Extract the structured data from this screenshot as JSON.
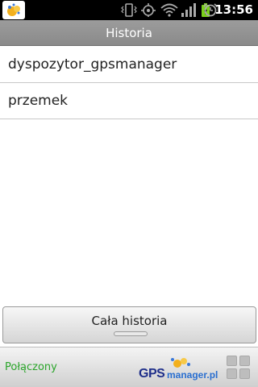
{
  "status_bar": {
    "time": "13:56",
    "icons": [
      "app-logo-icon",
      "vibrate-icon",
      "gps-icon",
      "wifi-icon",
      "signal-icon",
      "battery-icon",
      "alarm-icon"
    ]
  },
  "title": "Historia",
  "list": {
    "items": [
      {
        "label": "dyspozytor_gpsmanager"
      },
      {
        "label": "przemek"
      }
    ]
  },
  "button": {
    "label": "Cała historia"
  },
  "footer": {
    "status": "Połączony",
    "logo": {
      "gps": "GPS",
      "rest": "manager.pl"
    },
    "status_color": "#2aa52a"
  }
}
